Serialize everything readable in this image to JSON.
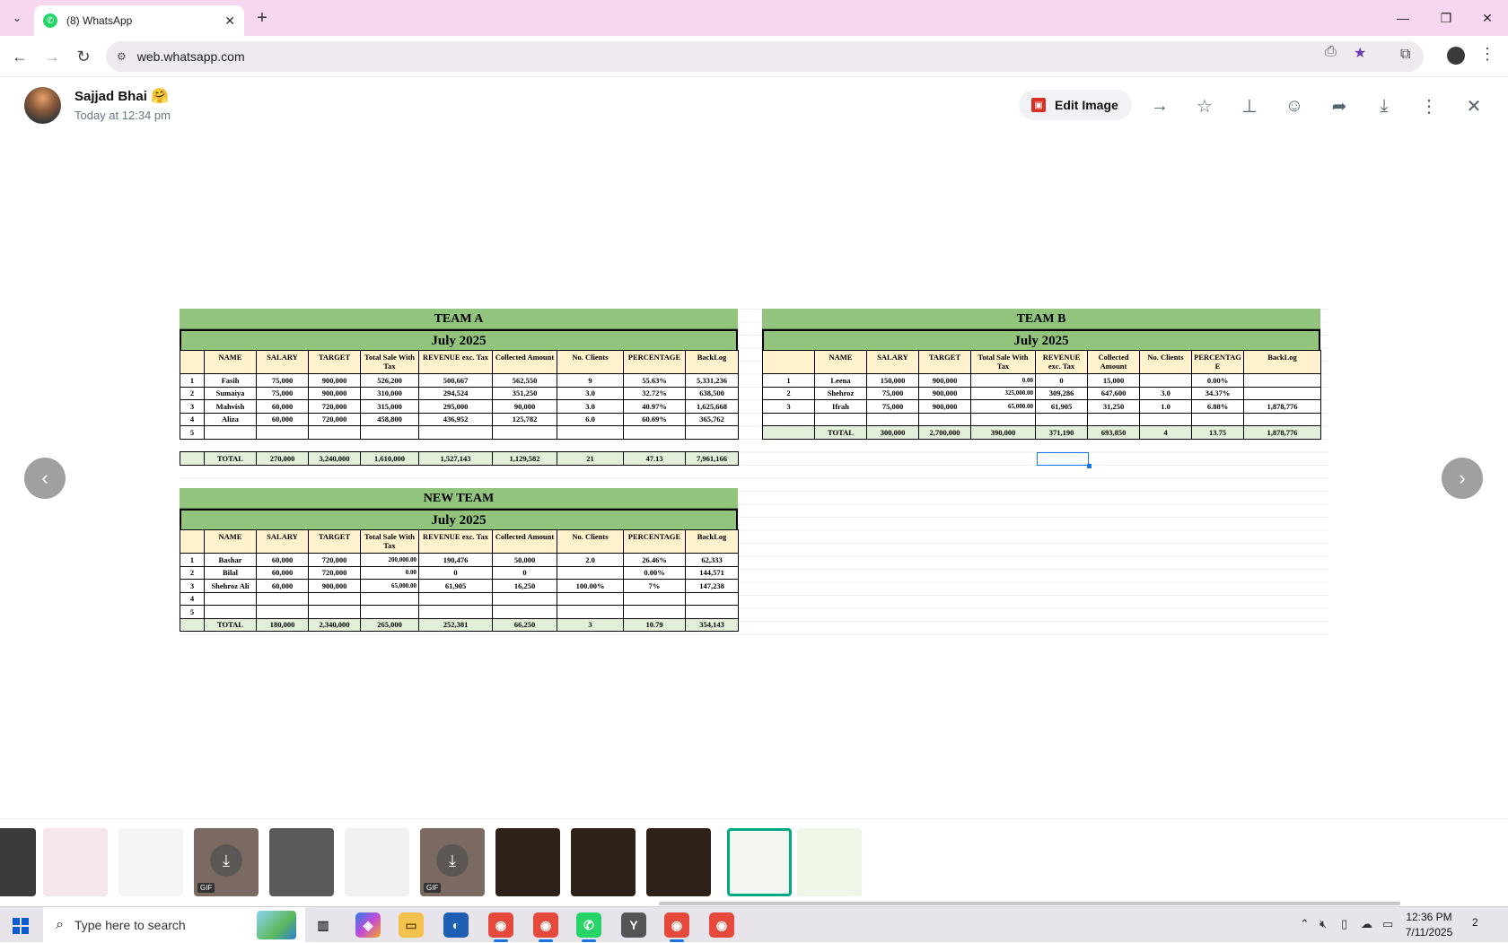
{
  "browser": {
    "tab_title": "(8) WhatsApp",
    "url": "web.whatsapp.com"
  },
  "viewer": {
    "sender_name": "Sajjad Bhai",
    "sender_emoji": "🤗",
    "timestamp": "Today at 12:34 pm",
    "edit_label": "Edit Image"
  },
  "sheet": {
    "team_a": {
      "title": "TEAM A",
      "month": "July 2025",
      "headers": [
        "",
        "NAME",
        "SALARY",
        "TARGET",
        "Total Sale With Tax",
        "REVENUE exc. Tax",
        "Collected Amount",
        "No. Clients",
        "PERCENTAGE",
        "BackLog"
      ],
      "rows": [
        [
          "1",
          "Fasih",
          "75,000",
          "900,000",
          "526,200",
          "500,667",
          "562,550",
          "9",
          "55.63%",
          "5,331,236"
        ],
        [
          "2",
          "Sumaiya",
          "75,000",
          "900,000",
          "310,000",
          "294,524",
          "351,250",
          "3.0",
          "32.72%",
          "638,500"
        ],
        [
          "3",
          "Mahvish",
          "60,000",
          "720,000",
          "315,000",
          "295,000",
          "90,000",
          "3.0",
          "40.97%",
          "1,625,668"
        ],
        [
          "4",
          "Aliza",
          "60,000",
          "720,000",
          "458,800",
          "436,952",
          "125,782",
          "6.0",
          "60.69%",
          "365,762"
        ],
        [
          "5",
          "",
          "",
          "",
          "",
          "",
          "",
          "",
          "",
          ""
        ]
      ],
      "total": [
        "",
        "TOTAL",
        "270,000",
        "3,240,000",
        "1,610,000",
        "1,527,143",
        "1,129,582",
        "21",
        "47.13",
        "7,961,166"
      ]
    },
    "team_b": {
      "title": "TEAM B",
      "month": "July 2025",
      "headers": [
        "",
        "NAME",
        "SALARY",
        "TARGET",
        "Total Sale With Tax",
        "REVENUE exc. Tax",
        "Collected Amount",
        "No. Clients",
        "PERCENTAG E",
        "BackLog"
      ],
      "rows": [
        [
          "1",
          "Leena",
          "150,000",
          "900,000",
          "0.00",
          "0",
          "15,000",
          "",
          "0.00%",
          ""
        ],
        [
          "2",
          "Shehroz",
          "75,000",
          "900,000",
          "325,000.00",
          "309,286",
          "647,600",
          "3.0",
          "34.37%",
          ""
        ],
        [
          "3",
          "Ifrah",
          "75,000",
          "900,000",
          "65,000.00",
          "61,905",
          "31,250",
          "1.0",
          "6.88%",
          "1,878,776"
        ],
        [
          "",
          "",
          "",
          "",
          "",
          "",
          "",
          "",
          "",
          ""
        ]
      ],
      "total": [
        "",
        "TOTAL",
        "300,000",
        "2,700,000",
        "390,000",
        "371,190",
        "693,850",
        "4",
        "13.75",
        "1,878,776"
      ]
    },
    "new_team": {
      "title": "NEW TEAM",
      "month": "July 2025",
      "headers": [
        "",
        "NAME",
        "SALARY",
        "TARGET",
        "Total Sale With Tax",
        "REVENUE exc. Tax",
        "Collected Amount",
        "No. Clients",
        "PERCENTAGE",
        "BackLog"
      ],
      "rows": [
        [
          "1",
          "Bashar",
          "60,000",
          "720,000",
          "200,000.00",
          "190,476",
          "50,000",
          "2.0",
          "26.46%",
          "62,333"
        ],
        [
          "2",
          "Bilal",
          "60,000",
          "720,000",
          "0.00",
          "0",
          "0",
          "",
          "0.00%",
          "144,571"
        ],
        [
          "3",
          "Shehroz Ali",
          "60,000",
          "900,000",
          "65,000.00",
          "61,905",
          "16,250",
          "100.00%",
          "7%",
          "147,238"
        ],
        [
          "4",
          "",
          "",
          "",
          "",
          "",
          "",
          "",
          "",
          ""
        ],
        [
          "5",
          "",
          "",
          "",
          "",
          "",
          "",
          "",
          "",
          ""
        ]
      ],
      "total": [
        "",
        "TOTAL",
        "180,000",
        "2,340,000",
        "265,000",
        "252,381",
        "66,250",
        "3",
        "10.79",
        "354,143"
      ]
    }
  },
  "thumbnails": [
    {
      "name": "thumb-photo-cat",
      "color": "#3b3b3b",
      "badge": ""
    },
    {
      "name": "thumb-doc-pink",
      "color": "#f4e6ec",
      "badge": ""
    },
    {
      "name": "thumb-doc-white",
      "color": "#f5f5f5",
      "badge": ""
    },
    {
      "name": "thumb-gif-1",
      "color": "#7a6a62",
      "badge": "GIF"
    },
    {
      "name": "thumb-mug",
      "color": "#5a5a5a",
      "badge": ""
    },
    {
      "name": "thumb-chat-screenshot",
      "color": "#f1f1f1",
      "badge": ""
    },
    {
      "name": "thumb-gif-2",
      "color": "#7a6a62",
      "badge": "GIF"
    },
    {
      "name": "thumb-dark-1",
      "color": "#2e2218",
      "badge": ""
    },
    {
      "name": "thumb-dark-2",
      "color": "#2e2218",
      "badge": ""
    },
    {
      "name": "thumb-dark-3",
      "color": "#2e2218",
      "badge": ""
    },
    {
      "name": "thumb-sheet-active",
      "color": "#f4f7f0",
      "badge": ""
    },
    {
      "name": "thumb-sheet-2",
      "color": "#eef6e8",
      "badge": ""
    }
  ],
  "taskbar": {
    "search_placeholder": "Type here to search",
    "time": "12:36 PM",
    "date": "7/11/2025",
    "notification_count": "2"
  },
  "colors": {
    "header_green": "#92c47d",
    "header_cream": "#fff2cc",
    "tab_bar": "#f7d7ef",
    "whatsapp_green": "#00a884"
  }
}
